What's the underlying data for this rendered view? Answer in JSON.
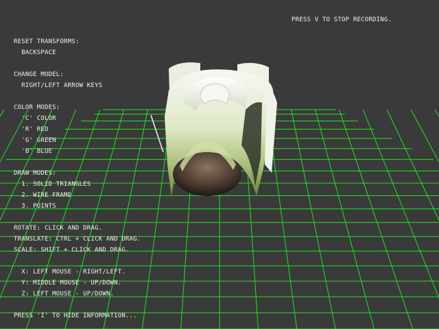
{
  "recording_hint": "PRESS V TO STOP RECORDING.",
  "info_lines": [
    "RESET TRANSFORMS:",
    "  BACKSPACE",
    "CHANGE MODEL:",
    "  RIGHT/LEFT ARROW KEYS",
    "COLOR MODES:",
    "  'C' COLOR",
    "  'R' RED",
    "  'G' GREEN",
    "  'B' BLUE",
    "DRAW MODES:",
    "  1. SOLID TRIANGLES",
    "  2. WIRE FRAME",
    "  3. POINTS",
    "ROTATE: CLICK AND DRAG.",
    "TRANSLATE: CTRL + CLICK AND DRAG.",
    "SCALE: SHIFT + CLICK AND DRAG.",
    "  X: LEFT MOUSE - RIGHT/LEFT.",
    "  Y: MIDDLE MOUSE - UP/DOWN.",
    "  Z: LEFT MOUSE - UP/DOWN.",
    "PRESS 'I' TO HIDE INFORMATION..."
  ],
  "colors": {
    "background": "#3a3a3a",
    "grid": "#1fe41f",
    "text": "#f2f2f2",
    "model_light": "#f4f6ee",
    "model_green": "#c7dca4",
    "model_shadow": "#5a4b3e"
  }
}
